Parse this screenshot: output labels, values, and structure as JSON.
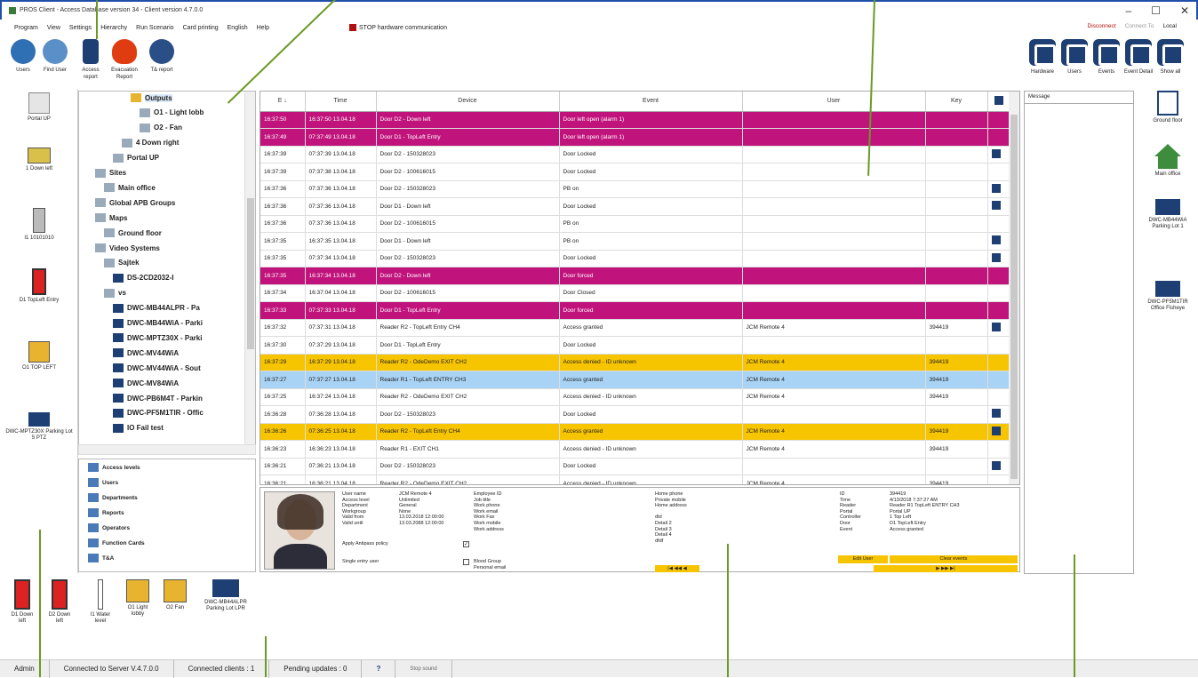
{
  "window": {
    "title": "PROS Client - Access Database version 34 - Client version 4.7.0.0",
    "controls": [
      "–",
      "☐",
      "✕"
    ]
  },
  "menu": [
    "Program",
    "View",
    "Settings",
    "Hierarchy",
    "Run Scenario",
    "Card printing",
    "English",
    "Help"
  ],
  "stop_label": "STOP hardware communication",
  "top_right": {
    "disconnect": "Disconnect",
    "connect_to": "Connect To",
    "local": "Local"
  },
  "toolbar_left": [
    {
      "label": "Users",
      "icon": "users-icon",
      "color": "#2f6fb3"
    },
    {
      "label": "Find User",
      "icon": "find-user-icon",
      "color": "#5a8fc7"
    },
    {
      "label": "Access report",
      "icon": "door-icon",
      "color": "#1e3f73"
    },
    {
      "label": "Evacuation Report",
      "icon": "fire-icon",
      "color": "#e03c12"
    },
    {
      "label": "T& report",
      "icon": "clock-users-icon",
      "color": "#2a4e86"
    }
  ],
  "toolbar_right": [
    {
      "label": "Hardware"
    },
    {
      "label": "Users"
    },
    {
      "label": "Events"
    },
    {
      "label": "Event Detail"
    },
    {
      "label": "Show all"
    }
  ],
  "left_devices": [
    {
      "label": "Portal UP",
      "icon": "portal-icon"
    },
    {
      "label": "1 Down left",
      "icon": "controller-icon"
    },
    {
      "label": "I1 10101010",
      "icon": "reader-icon"
    },
    {
      "label": "D1 TopLeft Entry",
      "icon": "door-red-icon"
    },
    {
      "label": "O1 TOP LEFT",
      "icon": "relay-icon"
    },
    {
      "label": "DWC-MPTZ30X Parking Lot 5 PTZ",
      "icon": "camera-icon"
    }
  ],
  "tree": [
    {
      "label": "Outputs",
      "indent": 5,
      "highlight": true
    },
    {
      "label": "O1 - Light lobb",
      "indent": 6
    },
    {
      "label": "O2 - Fan",
      "indent": 6
    },
    {
      "label": "4 Down right",
      "indent": 4
    },
    {
      "label": "Portal UP",
      "indent": 3
    },
    {
      "label": "Sites",
      "indent": 1
    },
    {
      "label": "Main office",
      "indent": 2
    },
    {
      "label": "Global APB Groups",
      "indent": 1
    },
    {
      "label": "Maps",
      "indent": 1
    },
    {
      "label": "Ground floor",
      "indent": 2
    },
    {
      "label": "Video Systems",
      "indent": 1
    },
    {
      "label": "Sajtek",
      "indent": 2
    },
    {
      "label": "DS-2CD2032-I",
      "indent": 3
    },
    {
      "label": "vs",
      "indent": 2
    },
    {
      "label": "DWC-MB44ALPR - Pa",
      "indent": 3
    },
    {
      "label": "DWC-MB44WiA - Parki",
      "indent": 3
    },
    {
      "label": "DWC-MPTZ30X - Parki",
      "indent": 3
    },
    {
      "label": "DWC-MV44WiA",
      "indent": 3
    },
    {
      "label": "DWC-MV44WiA - Sout",
      "indent": 3
    },
    {
      "label": "DWC-MV84WiA",
      "indent": 3
    },
    {
      "label": "DWC-PB6M4T - Parkin",
      "indent": 3
    },
    {
      "label": "DWC-PF5M1TIR - Offic",
      "indent": 3
    },
    {
      "label": "IO Fail test",
      "indent": 3
    }
  ],
  "tree2": [
    {
      "label": "Access levels"
    },
    {
      "label": "Users"
    },
    {
      "label": "Departments"
    },
    {
      "label": "Reports"
    },
    {
      "label": "Operators"
    },
    {
      "label": "Function Cards"
    },
    {
      "label": "T&A"
    }
  ],
  "grid": {
    "headers": [
      "E ↓",
      "Time",
      "Device",
      "Event",
      "User",
      "Key",
      ""
    ],
    "rows": [
      {
        "e": "16:37:50",
        "time": "16:37:50 13.04.18",
        "device": "Door D2 - Down left",
        "event": "Door left open (alarm 1)",
        "user": "",
        "key": "",
        "cam": false,
        "style": "magenta"
      },
      {
        "e": "16:37:49",
        "time": "07:37:49 13.04.18",
        "device": "Door D1 - TopLeft Entry",
        "event": "Door left open (alarm 1)",
        "user": "",
        "key": "",
        "cam": false,
        "style": "magenta"
      },
      {
        "e": "16:37:39",
        "time": "07:37:39 13.04.18",
        "device": "Door D2 - 150328023",
        "event": "Door Locked",
        "user": "",
        "key": "",
        "cam": true,
        "style": ""
      },
      {
        "e": "16:37:39",
        "time": "07:37:38 13.04.18",
        "device": "Door D2 - 100616015",
        "event": "Door Locked",
        "user": "",
        "key": "",
        "cam": false,
        "style": ""
      },
      {
        "e": "16:37:36",
        "time": "07:37:36 13.04.18",
        "device": "Door D2 - 150328023",
        "event": "PB on",
        "user": "",
        "key": "",
        "cam": true,
        "style": ""
      },
      {
        "e": "16:37:36",
        "time": "07:37:36 13.04.18",
        "device": "Door D1 - Down left",
        "event": "Door Locked",
        "user": "",
        "key": "",
        "cam": true,
        "style": ""
      },
      {
        "e": "16:37:36",
        "time": "07:37:36 13.04.18",
        "device": "Door D2 - 100616015",
        "event": "PB on",
        "user": "",
        "key": "",
        "cam": false,
        "style": ""
      },
      {
        "e": "16:37:35",
        "time": "16:37:35 13.04.18",
        "device": "Door D1 - Down left",
        "event": "PB on",
        "user": "",
        "key": "",
        "cam": true,
        "style": ""
      },
      {
        "e": "16:37:35",
        "time": "07:37:34 13.04.18",
        "device": "Door D2 - 150328023",
        "event": "Door Locked",
        "user": "",
        "key": "",
        "cam": true,
        "style": ""
      },
      {
        "e": "16:37:35",
        "time": "16:37:34 13.04.18",
        "device": "Door D2 - Down left",
        "event": "Door forced",
        "user": "",
        "key": "",
        "cam": false,
        "style": "magenta"
      },
      {
        "e": "16:37:34",
        "time": "16:37:04 13.04.18",
        "device": "Door D2 - 100616015",
        "event": "Door Closed",
        "user": "",
        "key": "",
        "cam": false,
        "style": ""
      },
      {
        "e": "16:37:33",
        "time": "07:37:33 13.04.18",
        "device": "Door D1 - TopLeft Entry",
        "event": "Door forced",
        "user": "",
        "key": "",
        "cam": false,
        "style": "magenta"
      },
      {
        "e": "16:37:32",
        "time": "07:37:31 13.04.18",
        "device": "Reader R2 - TopLeft Entry CH4",
        "event": "Access granted",
        "user": "JCM Remote 4",
        "key": "394419",
        "cam": true,
        "style": ""
      },
      {
        "e": "16:37:30",
        "time": "07:37:29 13.04.18",
        "device": "Door D1 - TopLeft Entry",
        "event": "Door Locked",
        "user": "",
        "key": "",
        "cam": false,
        "style": ""
      },
      {
        "e": "16:37:29",
        "time": "16:37:29 13.04.18",
        "device": "Reader R2 - OdeDemo EXIT CH2",
        "event": "Access denied - ID unknown",
        "user": "JCM Remote 4",
        "key": "394419",
        "cam": false,
        "style": "yellow"
      },
      {
        "e": "16:37:27",
        "time": "07:37:27 13.04.18",
        "device": "Reader R1 - TopLeft ENTRY CH3",
        "event": "Access granted",
        "user": "JCM Remote 4",
        "key": "394419",
        "cam": false,
        "style": "blue"
      },
      {
        "e": "16:37:25",
        "time": "16:37:24 13.04.18",
        "device": "Reader R2 - OdeDemo EXIT CH2",
        "event": "Access denied - ID unknown",
        "user": "JCM Remote 4",
        "key": "394419",
        "cam": false,
        "style": ""
      },
      {
        "e": "16:36:28",
        "time": "07:36:28 13.04.18",
        "device": "Door D2 - 150328023",
        "event": "Door Locked",
        "user": "",
        "key": "",
        "cam": true,
        "style": ""
      },
      {
        "e": "16:36:26",
        "time": "07:36:25 13.04.18",
        "device": "Reader R2 - TopLeft Entry CH4",
        "event": "Access granted",
        "user": "JCM Remote 4",
        "key": "394419",
        "cam": true,
        "style": "yellow"
      },
      {
        "e": "16:36:23",
        "time": "16:36:23 13.04.18",
        "device": "Reader R1 - EXIT CH1",
        "event": "Access denied - ID unknown",
        "user": "JCM Remote 4",
        "key": "394419",
        "cam": false,
        "style": ""
      },
      {
        "e": "16:36:21",
        "time": "07:36:21 13.04.18",
        "device": "Door D2 - 150328023",
        "event": "Door Locked",
        "user": "",
        "key": "",
        "cam": true,
        "style": ""
      },
      {
        "e": "16:36:21",
        "time": "16:36:21 13.04.18",
        "device": "Reader R2 - OdeDemo EXIT CH2",
        "event": "Access denied - ID unknown",
        "user": "JCM Remote 4",
        "key": "394419",
        "cam": false,
        "style": ""
      }
    ]
  },
  "detail": {
    "col1_labels": [
      "User name",
      "Access level",
      "Department",
      "Workgroup",
      "Valid from",
      "Valid until"
    ],
    "col1_values": [
      "JCM Remote 4",
      "Unlimited",
      "General",
      "None",
      "13.03.2018 12:00:00",
      "13.03.2088 12:00:00"
    ],
    "col2_labels": [
      "Employee ID",
      "Job title",
      "Work phone",
      "Work email",
      "Work Fax",
      "Work mobile",
      "Work address"
    ],
    "col3_labels": [
      "Home phone",
      "Private mobile",
      "Home address",
      "",
      "dtd",
      "Detail 2",
      "Detail 3",
      "Detail 4",
      "dfdf"
    ],
    "antipass": "Apply Antipass policy",
    "single_entry": "Single entry user",
    "blood": "Blood Group",
    "personal_email": "Personal email",
    "col4_labels": [
      "ID",
      "Time",
      "Reader",
      "Portal",
      "Controller",
      "Door",
      "Event"
    ],
    "col4_values": [
      "394419",
      "4/13/2018 7:37:27 AM",
      "Reader R1 TopLeft ENTRY CH3",
      "Portal UP",
      "1 Top Left",
      "D1 TopLeft Entry",
      "Access granted"
    ],
    "edit_user": "Edit User",
    "clear_events": "Clear events"
  },
  "message_header": "Message",
  "right_devices": [
    {
      "label": "Ground floor",
      "icon": "floorplan-icon"
    },
    {
      "label": "Main office",
      "icon": "home-icon"
    },
    {
      "label": "DWC-MB44WiA Parking Lot 1",
      "icon": "camera-icon"
    },
    {
      "label": "DWC-PF5M1TIR Office Fisheye",
      "icon": "camera-icon"
    }
  ],
  "bottom_devices": [
    {
      "label": "D1 Down left",
      "icon": "door-red-icon"
    },
    {
      "label": "D2 Down left",
      "icon": "door-red-icon"
    },
    {
      "label": "I1 Water level",
      "icon": "input-icon"
    },
    {
      "label": "O1 Light lobby",
      "icon": "relay-icon"
    },
    {
      "label": "O2 Fan",
      "icon": "relay-icon"
    },
    {
      "label": "DWC-MB44ALPR Parking Lot LPR",
      "icon": "camera-icon"
    }
  ],
  "status": {
    "user": "Admin",
    "server": "Connected to Server V.4.7.0.0",
    "clients": "Connected clients : 1",
    "pending": "Pending updates : 0",
    "help": "?",
    "stop_sound": "Stop sound"
  },
  "colors": {
    "magenta": "#c0147c",
    "yellow": "#f7c400",
    "blue": "#a9d3f5",
    "navy": "#1e3f73",
    "callout": "#6a9a25"
  }
}
